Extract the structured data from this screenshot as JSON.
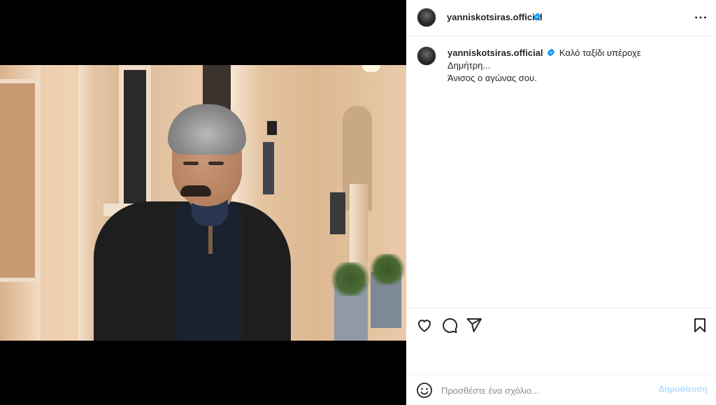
{
  "post": {
    "author": "yanniskotsiras.official",
    "verified": true,
    "caption_author": "yanniskotsiras.official",
    "caption_line1": "Καλό ταξίδι υπέροχε Δημήτρη...",
    "caption_line2": "Άνισος ο αγώνας σου."
  },
  "header_icons": {
    "more": "more-options-icon"
  },
  "actions": {
    "icons": [
      "heart-icon",
      "comment-icon",
      "share-icon",
      "bookmark-icon"
    ]
  },
  "comment_box": {
    "placeholder": "Προσθέστε ένα σχόλιο...",
    "post_label": "Δημοσίευση",
    "emoji_icon": "emoji-icon"
  },
  "colors": {
    "verified_blue": "#0095f6",
    "post_button_disabled": "#b3dbff",
    "media_bg": "#000000"
  }
}
